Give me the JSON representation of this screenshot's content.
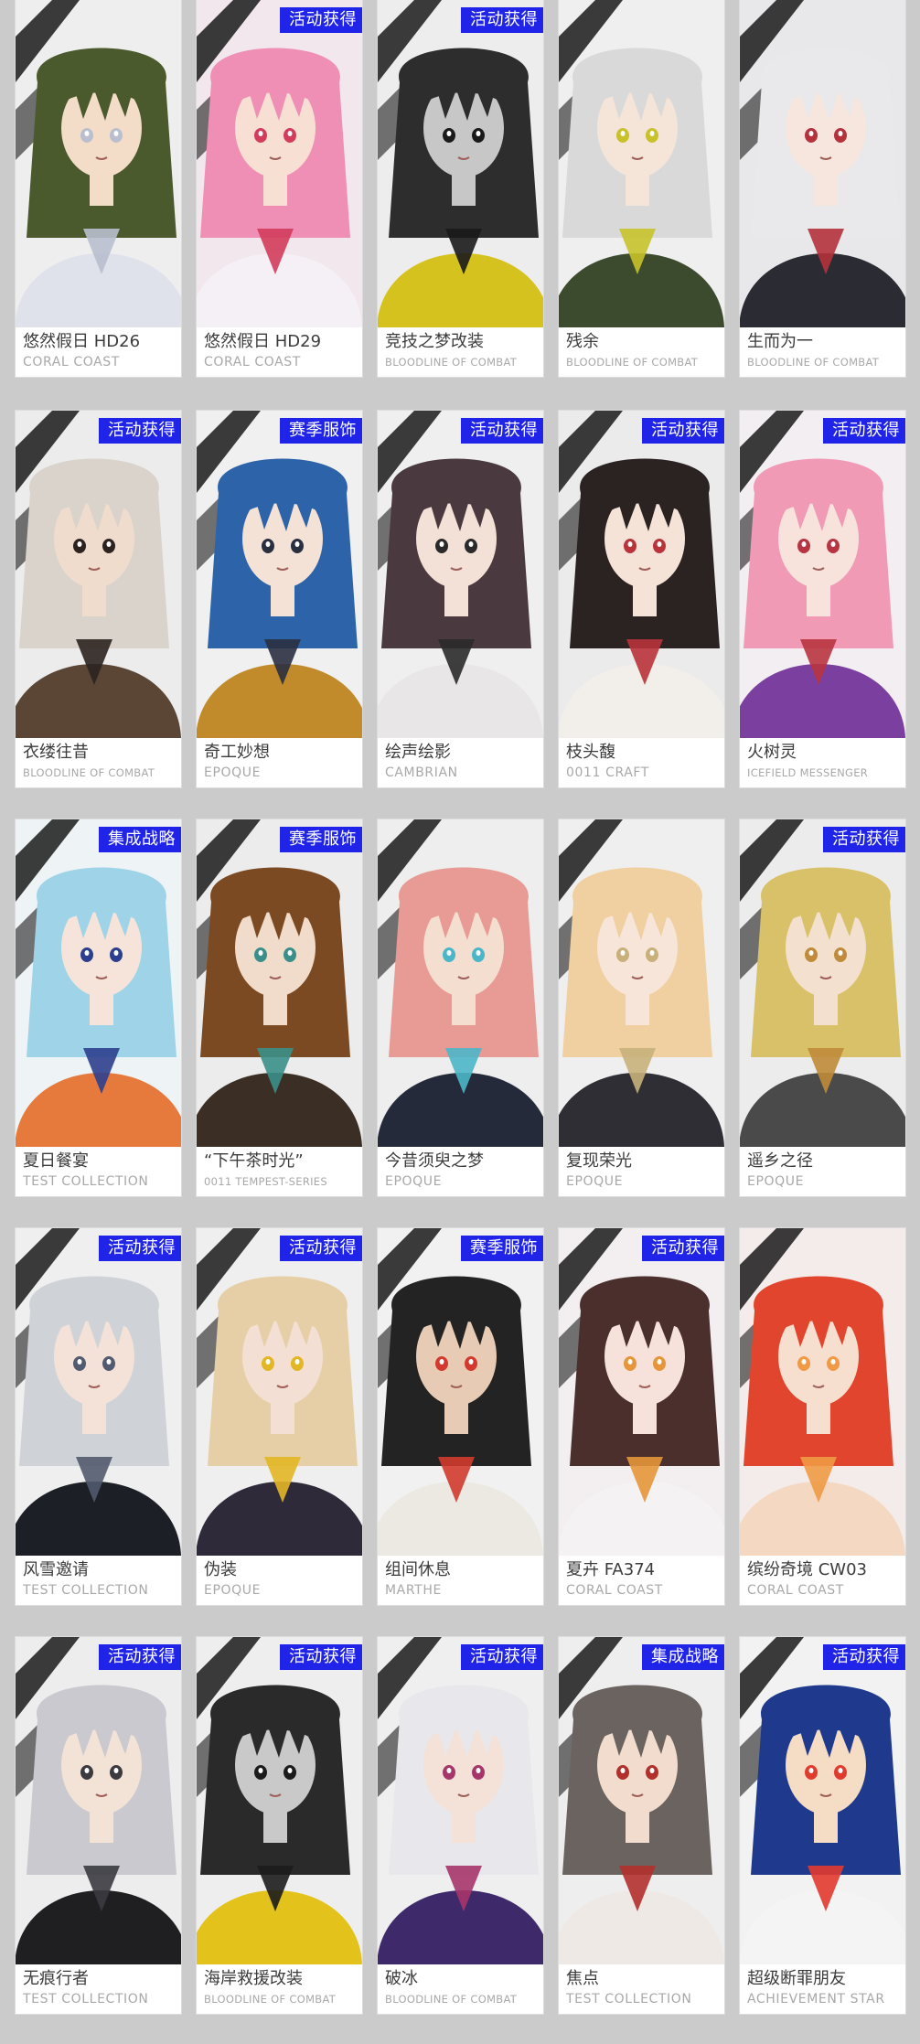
{
  "outfits": [
    {
      "name": "悠然假日 HD26",
      "series": "CORAL COAST",
      "badge": "",
      "palette": {
        "bg": "#eeeeee",
        "hair": "#4b5a2c",
        "skin": "#f3dcc8",
        "outfit": "#dfe2ea",
        "accent": "#b9bfcf"
      }
    },
    {
      "name": "悠然假日 HD29",
      "series": "CORAL COAST",
      "badge": "活动获得",
      "palette": {
        "bg": "#f1e7ec",
        "hair": "#f08fb5",
        "skin": "#f7e0d3",
        "outfit": "#f4f0f6",
        "accent": "#d33c5c"
      }
    },
    {
      "name": "竞技之梦改装",
      "series": "BLOODLINE OF COMBAT",
      "badge": "活动获得",
      "palette": {
        "bg": "#ededed",
        "hair": "#2d2d2d",
        "skin": "#c7c7c7",
        "outfit": "#d6c21f",
        "accent": "#1a1a1a"
      }
    },
    {
      "name": "残余",
      "series": "BLOODLINE OF COMBAT",
      "badge": "",
      "palette": {
        "bg": "#efefef",
        "hair": "#d9d9d9",
        "skin": "#f5e4d8",
        "outfit": "#3c4a2e",
        "accent": "#c7c22a"
      }
    },
    {
      "name": "生而为一",
      "series": "BLOODLINE OF COMBAT",
      "badge": "",
      "palette": {
        "bg": "#e8e8ea",
        "hair": "#e9e9ec",
        "skin": "#f6e6dd",
        "outfit": "#2b2b33",
        "accent": "#b4323c"
      }
    },
    {
      "name": "衣缕往昔",
      "series": "BLOODLINE OF COMBAT",
      "badge": "活动获得",
      "palette": {
        "bg": "#ececec",
        "hair": "#d9d3cc",
        "skin": "#efdccd",
        "outfit": "#5b4535",
        "accent": "#2c2320"
      }
    },
    {
      "name": "奇工妙想",
      "series": "EPOQUE",
      "badge": "赛季服饰",
      "palette": {
        "bg": "#f0f0f0",
        "hair": "#2d63a8",
        "skin": "#f4e2d6",
        "outfit": "#c18a2a",
        "accent": "#2a2f40"
      }
    },
    {
      "name": "绘声绘影",
      "series": "CAMBRIAN",
      "badge": "活动获得",
      "palette": {
        "bg": "#efefef",
        "hair": "#4a3a3f",
        "skin": "#f3e0d6",
        "outfit": "#e8e6e6",
        "accent": "#2a2a2a"
      }
    },
    {
      "name": "枝头馥",
      "series": "0011 CRAFT",
      "badge": "活动获得",
      "palette": {
        "bg": "#ebebeb",
        "hair": "#2b2222",
        "skin": "#f5e3d8",
        "outfit": "#f2eeea",
        "accent": "#b8333a"
      }
    },
    {
      "name": "火树灵",
      "series": "ICEFIELD MESSENGER",
      "badge": "活动获得",
      "palette": {
        "bg": "#f2eef2",
        "hair": "#f09ab6",
        "skin": "#f7e3dc",
        "outfit": "#7b3fa0",
        "accent": "#b83440"
      }
    },
    {
      "name": "夏日餐宴",
      "series": "TEST COLLECTION",
      "badge": "集成战略",
      "palette": {
        "bg": "#eef3f6",
        "hair": "#9fd3e8",
        "skin": "#f6e4da",
        "outfit": "#e67a3c",
        "accent": "#2c3f8e"
      }
    },
    {
      "name": "“下午茶时光”",
      "series": "0011 TEMPEST-SERIES",
      "badge": "赛季服饰",
      "palette": {
        "bg": "#ececec",
        "hair": "#7c4a22",
        "skin": "#f1dccb",
        "outfit": "#3b2e24",
        "accent": "#3b8f8a"
      }
    },
    {
      "name": "今昔须臾之梦",
      "series": "EPOQUE",
      "badge": "",
      "palette": {
        "bg": "#eeeeee",
        "hair": "#e89a94",
        "skin": "#f3ded0",
        "outfit": "#252a3a",
        "accent": "#4bb6c8"
      }
    },
    {
      "name": "复现荣光",
      "series": "EPOQUE",
      "badge": "",
      "palette": {
        "bg": "#efefef",
        "hair": "#f0cfa0",
        "skin": "#f6e5d8",
        "outfit": "#2e2e34",
        "accent": "#c8b07a"
      }
    },
    {
      "name": "遥乡之径",
      "series": "EPOQUE",
      "badge": "活动获得",
      "palette": {
        "bg": "#ececec",
        "hair": "#d8c169",
        "skin": "#f3e0cf",
        "outfit": "#4a4a4a",
        "accent": "#c08b3a"
      }
    },
    {
      "name": "风雪邀请",
      "series": "TEST COLLECTION",
      "badge": "活动获得",
      "palette": {
        "bg": "#efefef",
        "hair": "#cfd3d8",
        "skin": "#f4e2d8",
        "outfit": "#1d1f26",
        "accent": "#515a6e"
      }
    },
    {
      "name": "伪装",
      "series": "EPOQUE",
      "badge": "活动获得",
      "palette": {
        "bg": "#efefef",
        "hair": "#e6cfa6",
        "skin": "#f3dfd3",
        "outfit": "#2e2a3a",
        "accent": "#e3b626"
      }
    },
    {
      "name": "组间休息",
      "series": "MARTHE",
      "badge": "赛季服饰",
      "palette": {
        "bg": "#f1f1f1",
        "hair": "#232323",
        "skin": "#e8cbb4",
        "outfit": "#ece8e2",
        "accent": "#d23a2e"
      }
    },
    {
      "name": "夏卉 FA374",
      "series": "CORAL COAST",
      "badge": "活动获得",
      "palette": {
        "bg": "#f3eff0",
        "hair": "#4a2f2d",
        "skin": "#f6e2da",
        "outfit": "#f4f2f2",
        "accent": "#e6963a"
      }
    },
    {
      "name": "缤纷奇境 CW03",
      "series": "CORAL COAST",
      "badge": "",
      "palette": {
        "bg": "#f4ecea",
        "hair": "#e2452e",
        "skin": "#f6dfcf",
        "outfit": "#f5d8c2",
        "accent": "#f09a45"
      }
    },
    {
      "name": "无痕行者",
      "series": "TEST COLLECTION",
      "badge": "活动获得",
      "palette": {
        "bg": "#ededed",
        "hair": "#c9c9cf",
        "skin": "#f3e2d6",
        "outfit": "#1f1f22",
        "accent": "#3a3a40"
      }
    },
    {
      "name": "海岸救援改装",
      "series": "BLOODLINE OF COMBAT",
      "badge": "活动获得",
      "palette": {
        "bg": "#eeeeee",
        "hair": "#2a2a2a",
        "skin": "#c9c9c9",
        "outfit": "#e4c21c",
        "accent": "#1c1c1c"
      }
    },
    {
      "name": "破冰",
      "series": "BLOODLINE OF COMBAT",
      "badge": "活动获得",
      "palette": {
        "bg": "#efefef",
        "hair": "#e8e8ec",
        "skin": "#f4e1d7",
        "outfit": "#3e2a6b",
        "accent": "#a6356a"
      }
    },
    {
      "name": "焦点",
      "series": "TEST COLLECTION",
      "badge": "集成战略",
      "palette": {
        "bg": "#eeeeee",
        "hair": "#6b6360",
        "skin": "#f1dccd",
        "outfit": "#efe9e6",
        "accent": "#b2302c"
      }
    },
    {
      "name": "超级断罪朋友",
      "series": "ACHIEVEMENT STAR",
      "badge": "活动获得",
      "palette": {
        "bg": "#f2f2f2",
        "hair": "#1f3a8c",
        "skin": "#f5dcc4",
        "outfit": "#f4f4f4",
        "accent": "#e23a2e"
      }
    }
  ]
}
